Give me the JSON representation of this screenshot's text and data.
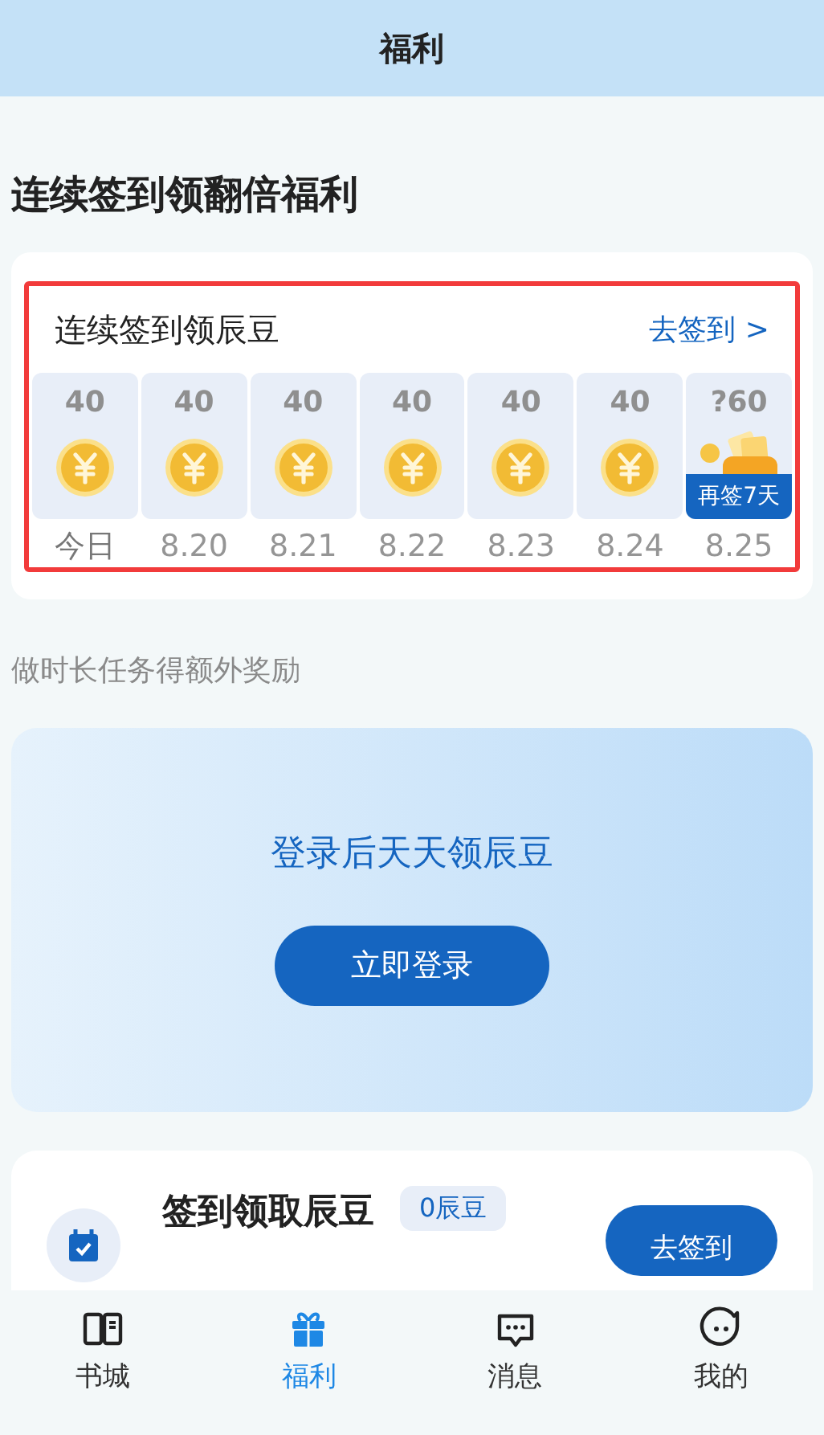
{
  "header": {
    "title": "福利"
  },
  "headline": "连续签到领翻倍福利",
  "checkin": {
    "title": "连续签到领辰豆",
    "link": "去签到 >",
    "days": [
      {
        "kind": "coin",
        "amount": "40",
        "date": "今日",
        "today": true
      },
      {
        "kind": "coin",
        "amount": "40",
        "date": "8.20",
        "today": false
      },
      {
        "kind": "coin",
        "amount": "40",
        "date": "8.21",
        "today": false
      },
      {
        "kind": "coin",
        "amount": "40",
        "date": "8.22",
        "today": false
      },
      {
        "kind": "coin",
        "amount": "40",
        "date": "8.23",
        "today": false
      },
      {
        "kind": "coin",
        "amount": "40",
        "date": "8.24",
        "today": false
      },
      {
        "kind": "bonus",
        "amount": "?60",
        "badge": "再签7天",
        "date": "8.25",
        "today": false
      }
    ]
  },
  "tasks_hint": "做时长任务得额外奖励",
  "login_card": {
    "message": "登录后天天领辰豆",
    "button": "立即登录"
  },
  "task": {
    "title": "签到领取辰豆",
    "badge": "0辰豆",
    "button": "去签到"
  },
  "tabbar": [
    {
      "label": "书城",
      "selected": false
    },
    {
      "label": "福利",
      "selected": true
    },
    {
      "label": "消息",
      "selected": false
    },
    {
      "label": "我的",
      "selected": false
    }
  ]
}
